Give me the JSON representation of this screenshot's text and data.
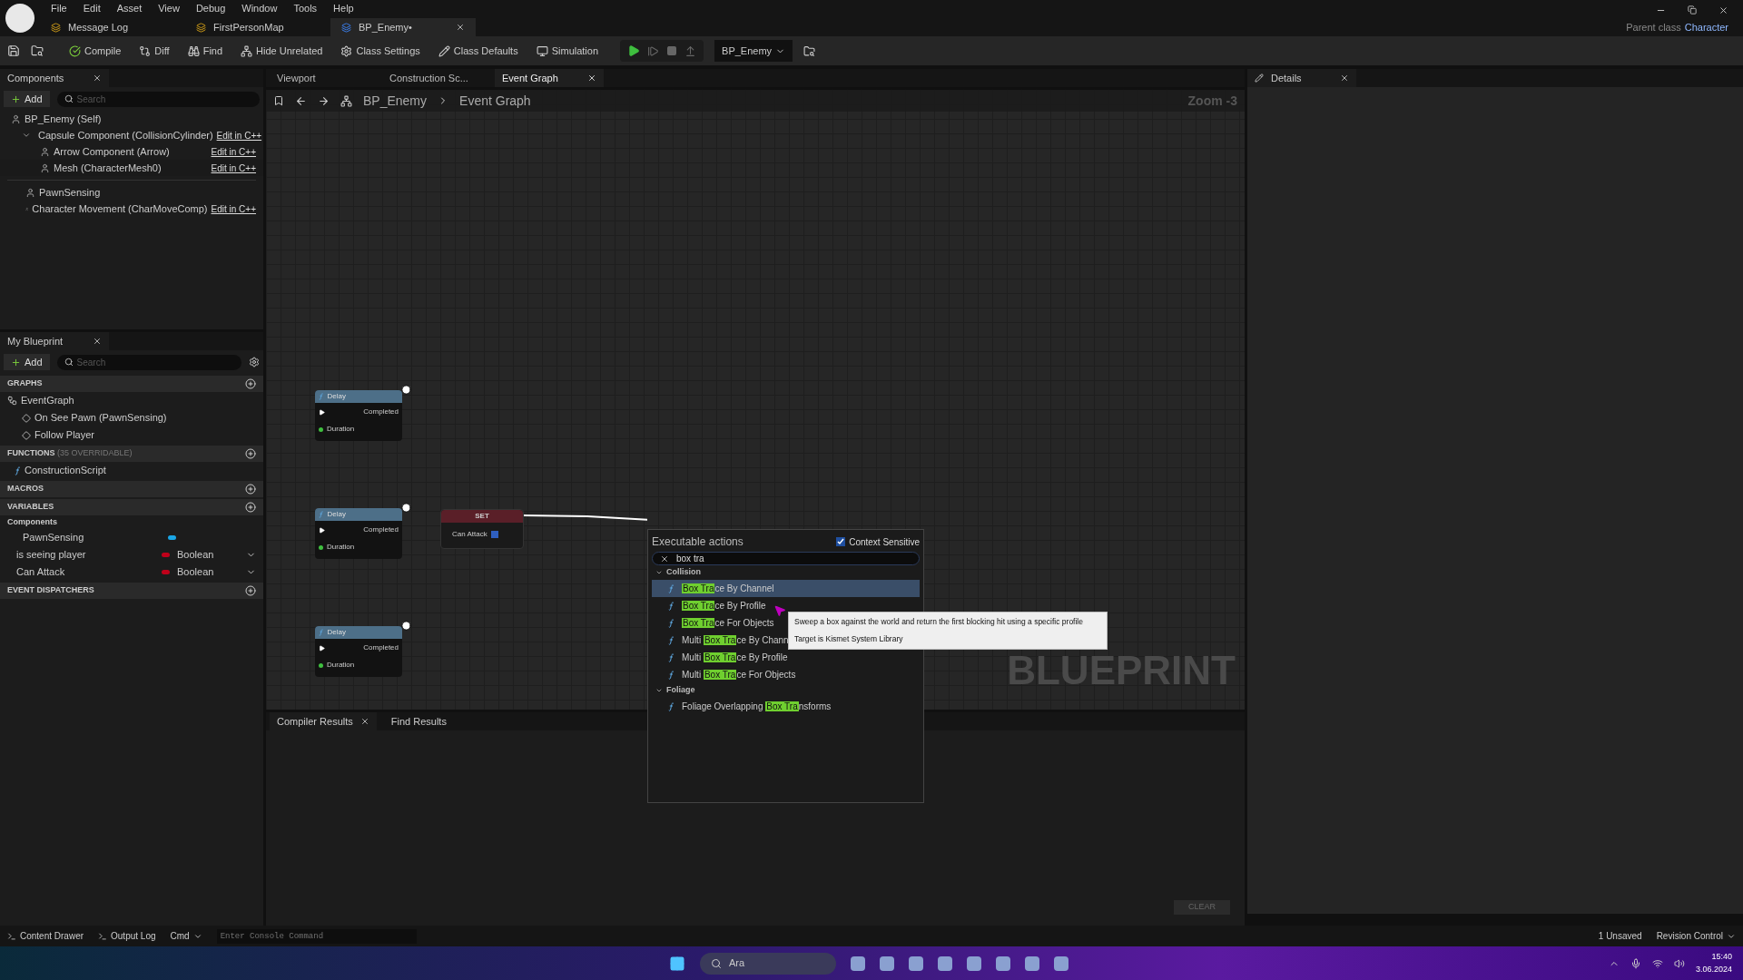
{
  "menu": [
    "File",
    "Edit",
    "Asset",
    "View",
    "Debug",
    "Window",
    "Tools",
    "Help"
  ],
  "doc_tabs": [
    {
      "label": "Message Log",
      "selected": false
    },
    {
      "label": "FirstPersonMap",
      "selected": false
    },
    {
      "label": "BP_Enemy•",
      "selected": true
    }
  ],
  "parent_class": {
    "label": "Parent class",
    "value": "Character"
  },
  "toolbar": [
    "Compile",
    "Diff",
    "Find",
    "Hide Unrelated",
    "Class Settings",
    "Class Defaults",
    "Simulation"
  ],
  "debug_selector": "BP_Enemy",
  "components": {
    "title": "Components",
    "add": "Add",
    "placeholder": "Search",
    "tree": [
      {
        "label": "BP_Enemy (Self)",
        "children": [
          {
            "label": "Capsule Component (CollisionCylinder)",
            "edit": "Edit in C++",
            "expanded": true,
            "children": [
              {
                "label": "Arrow Component (Arrow)",
                "edit": "Edit in C++"
              },
              {
                "label": "Mesh (CharacterMesh0)",
                "edit": "Edit in C++"
              }
            ]
          }
        ]
      },
      {
        "label": "PawnSensing"
      },
      {
        "label": "Character Movement (CharMoveComp)",
        "edit": "Edit in C++"
      }
    ]
  },
  "my_blueprint": {
    "title": "My Blueprint",
    "add": "Add",
    "placeholder": "Search",
    "graphs": {
      "label": "GRAPHS",
      "items": [
        {
          "label": "EventGraph",
          "children": [
            {
              "label": "On See Pawn (PawnSensing)"
            },
            {
              "label": "Follow Player"
            }
          ]
        }
      ]
    },
    "functions": {
      "label": "FUNCTIONS",
      "note": "(35 OVERRIDABLE)",
      "items": [
        "ConstructionScript"
      ]
    },
    "macros": {
      "label": "MACROS"
    },
    "variables": {
      "label": "VARIABLES",
      "group": "Components",
      "items": [
        {
          "name": "PawnSensing",
          "color": "#1aa6e6"
        },
        {
          "name": "is seeing player",
          "type": "Boolean",
          "color": "#c0001a"
        },
        {
          "name": "Can Attack",
          "type": "Boolean",
          "color": "#c0001a"
        }
      ]
    },
    "dispatchers": {
      "label": "EVENT DISPATCHERS"
    }
  },
  "editor_tabs": [
    {
      "label": "Viewport",
      "selected": false
    },
    {
      "label": "Construction Sc...",
      "selected": false
    },
    {
      "label": "Event Graph",
      "selected": true
    }
  ],
  "breadcrumb": [
    "BP_Enemy",
    "Event Graph"
  ],
  "zoom_label": "Zoom -3",
  "nodes": [
    {
      "title": "Delay",
      "out": "Completed",
      "in": "Duration"
    },
    {
      "title": "Delay",
      "out": "Completed",
      "in": "Duration"
    },
    {
      "title": "Delay",
      "out": "Completed",
      "in": "Duration"
    }
  ],
  "set_node": {
    "title": "SET",
    "var": "Can Attack",
    "checked": true
  },
  "watermark": "BLUEPRINT",
  "actions": {
    "title": "Executable actions",
    "context": {
      "label": "Context Sensitive",
      "checked": true
    },
    "query": "box tra",
    "categories": [
      {
        "label": "Collision",
        "items": [
          {
            "match": "Box Tra",
            "after": "ce By Channel",
            "selected": true
          },
          {
            "match": "Box Tra",
            "after": "ce By Profile",
            "selected": false
          },
          {
            "match": "Box Tra",
            "after": "ce For Objects",
            "selected": false
          },
          {
            "before": "Multi ",
            "match": "Box Tra",
            "after": "ce By Chann",
            "selected": false
          },
          {
            "before": "Multi ",
            "match": "Box Tra",
            "after": "ce By Profile",
            "selected": false
          },
          {
            "before": "Multi ",
            "match": "Box Tra",
            "after": "ce For Objects",
            "selected": false
          }
        ]
      },
      {
        "label": "Foliage",
        "items": [
          {
            "before": "Foliage Overlapping ",
            "match": "Box Tra",
            "after": "nsforms",
            "selected": false
          }
        ]
      }
    ]
  },
  "tooltip": [
    "Sweep a box against the world and return the first blocking hit using a specific profile",
    "Target is Kismet System Library"
  ],
  "details": {
    "title": "Details"
  },
  "bottom_tabs": [
    "Compiler Results",
    "Find Results"
  ],
  "clear": "CLEAR",
  "status": {
    "left": [
      "Content Drawer",
      "Output Log"
    ],
    "cmd": "Cmd",
    "console_placeholder": "Enter Console Command",
    "unsaved": "1 Unsaved",
    "revision": "Revision Control"
  },
  "taskbar": {
    "search": "Ara",
    "time": "15:40",
    "date": "3.06.2024"
  }
}
